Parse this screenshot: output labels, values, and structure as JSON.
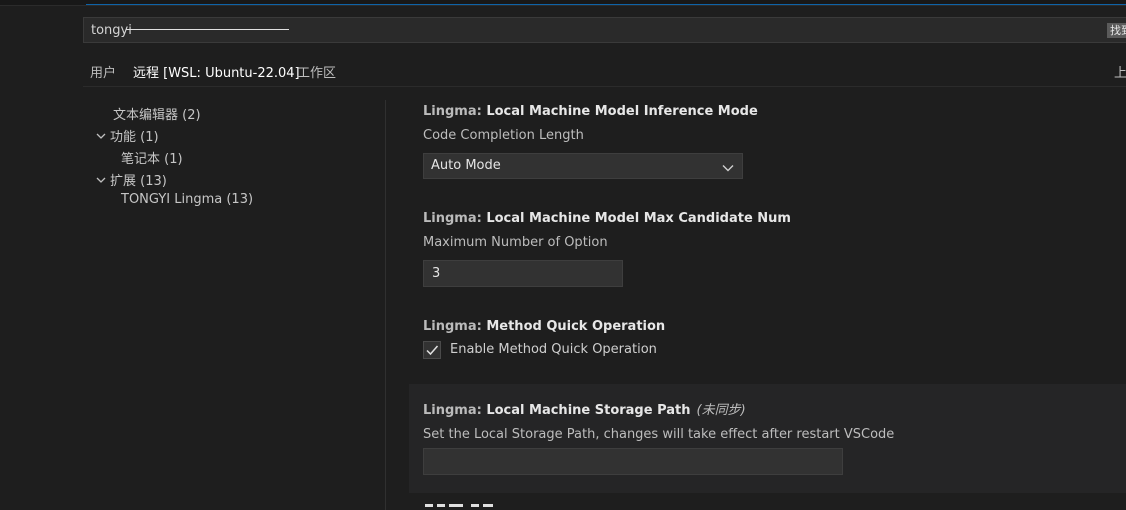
{
  "search": {
    "value": "tongyi",
    "filter_badge": "找到"
  },
  "tabs": [
    {
      "label": "用户"
    },
    {
      "label": "远程 [WSL: Ubuntu-22.04]"
    },
    {
      "label": "工作区"
    }
  ],
  "tab_right_label": "上",
  "toc": [
    {
      "label": "文本编辑器",
      "count": "(2)"
    },
    {
      "label": "功能",
      "count": "(1)"
    },
    {
      "label": "笔记本",
      "count": "(1)"
    },
    {
      "label": "扩展",
      "count": "(13)"
    },
    {
      "label": "TONGYI Lingma",
      "count": "(13)"
    }
  ],
  "settings": {
    "inference_mode": {
      "category": "Lingma: ",
      "title": "Local Machine Model Inference Mode",
      "description": "Code Completion Length",
      "value": "Auto Mode"
    },
    "max_candidate": {
      "category": "Lingma: ",
      "title": "Local Machine Model Max Candidate Num",
      "description": "Maximum Number of Option",
      "value": "3"
    },
    "quick_operation": {
      "category": "Lingma: ",
      "title": "Method Quick Operation",
      "checkbox_label": "Enable Method Quick Operation",
      "checked": true
    },
    "storage_path": {
      "category": "Lingma: ",
      "title": "Local Machine Storage Path",
      "modifier": "(未同步)",
      "description": "Set the Local Storage Path, changes will take effect after restart VSCode",
      "value": ""
    }
  },
  "colors": {
    "accent_blue": "#0e63a8",
    "background": "#1e1e1e"
  }
}
